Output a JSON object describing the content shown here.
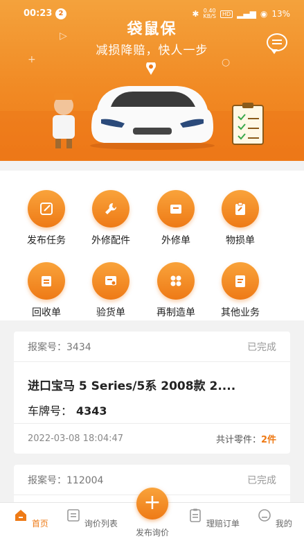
{
  "status_bar": {
    "time": "00:23",
    "notif_count": "2",
    "net_speed": "0.40",
    "net_unit": "KB/S",
    "hd": "HD",
    "battery": "13%"
  },
  "hero": {
    "title": "袋鼠保",
    "slogan": "减损降赔，快人一步"
  },
  "menu": {
    "items": [
      {
        "label": "发布任务",
        "icon": "edit-icon"
      },
      {
        "label": "外修配件",
        "icon": "wrench-icon"
      },
      {
        "label": "外修单",
        "icon": "folder-icon"
      },
      {
        "label": "物损单",
        "icon": "clipboard-icon"
      },
      {
        "label": "回收单",
        "icon": "calendar-icon"
      },
      {
        "label": "验货单",
        "icon": "inspect-icon"
      },
      {
        "label": "再制造单",
        "icon": "grid-icon"
      },
      {
        "label": "其他业务",
        "icon": "document-icon"
      }
    ]
  },
  "orders": [
    {
      "case_label": "报案号：",
      "case_no": "3434",
      "status": "已完成",
      "car": "进口宝马 5 Series/5系 2008款 2....",
      "plate_label": "车牌号：",
      "plate": "4343",
      "time": "2022-03-08 18:04:47",
      "parts_label": "共计零件：",
      "parts_count": "2件"
    },
    {
      "case_label": "报案号：",
      "case_no": "112004",
      "status": "已完成"
    }
  ],
  "tabs": [
    {
      "label": "首页",
      "icon": "home-icon",
      "active": true
    },
    {
      "label": "询价列表",
      "icon": "list-icon"
    },
    {
      "label": "发布询价",
      "icon": "plus-icon"
    },
    {
      "label": "理赔订单",
      "icon": "order-icon"
    },
    {
      "label": "我的",
      "icon": "profile-icon"
    }
  ],
  "colors": {
    "accent": "#ee7a16",
    "accent_light": "#f9a33b",
    "background": "#f2f2f2"
  }
}
